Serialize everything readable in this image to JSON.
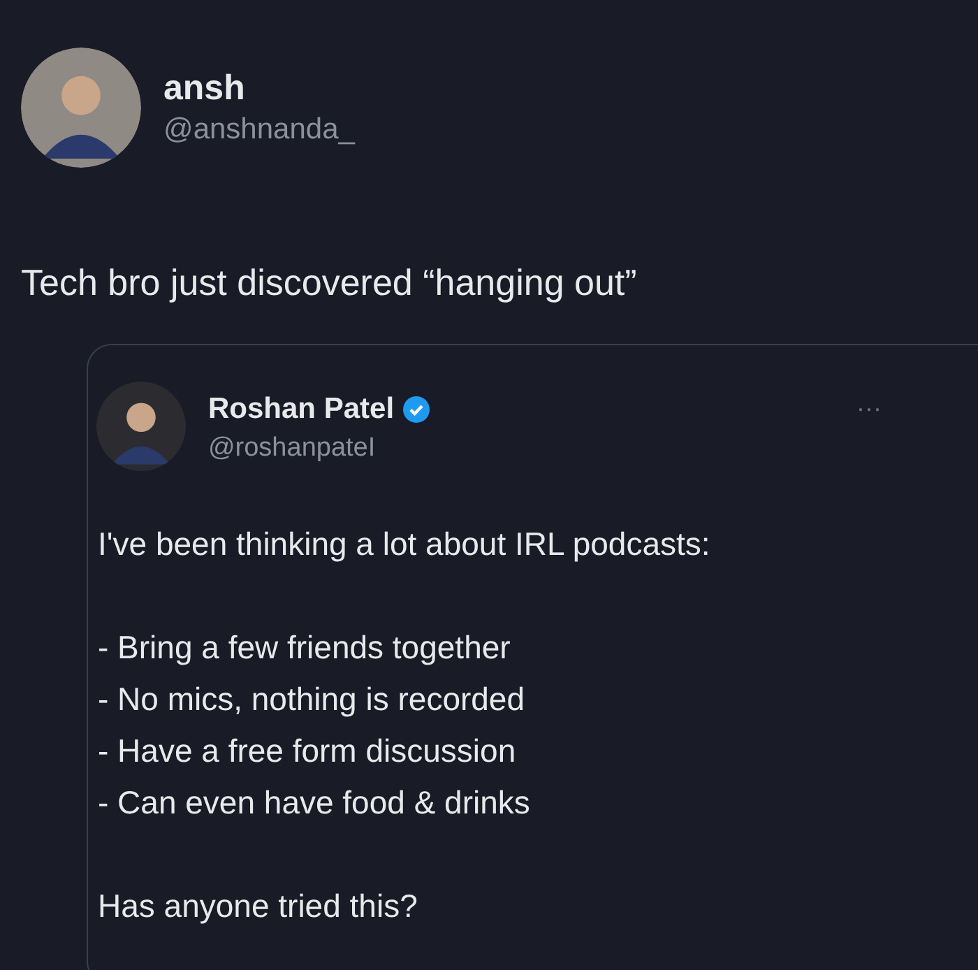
{
  "post": {
    "author": {
      "name": "ansh",
      "handle": "@anshnanda_"
    },
    "text": "Tech bro just discovered “hanging out”"
  },
  "quoted_post": {
    "author": {
      "name": "Roshan Patel",
      "handle": "@roshanpateI",
      "verified": true
    },
    "more": "···",
    "intro": "I've been thinking a lot about IRL podcasts:",
    "list": [
      "- Bring a few friends together",
      "- No mics, nothing is recorded",
      "- Have a free form discussion",
      "- Can even have food & drinks"
    ],
    "closing": "Has anyone tried this?"
  }
}
